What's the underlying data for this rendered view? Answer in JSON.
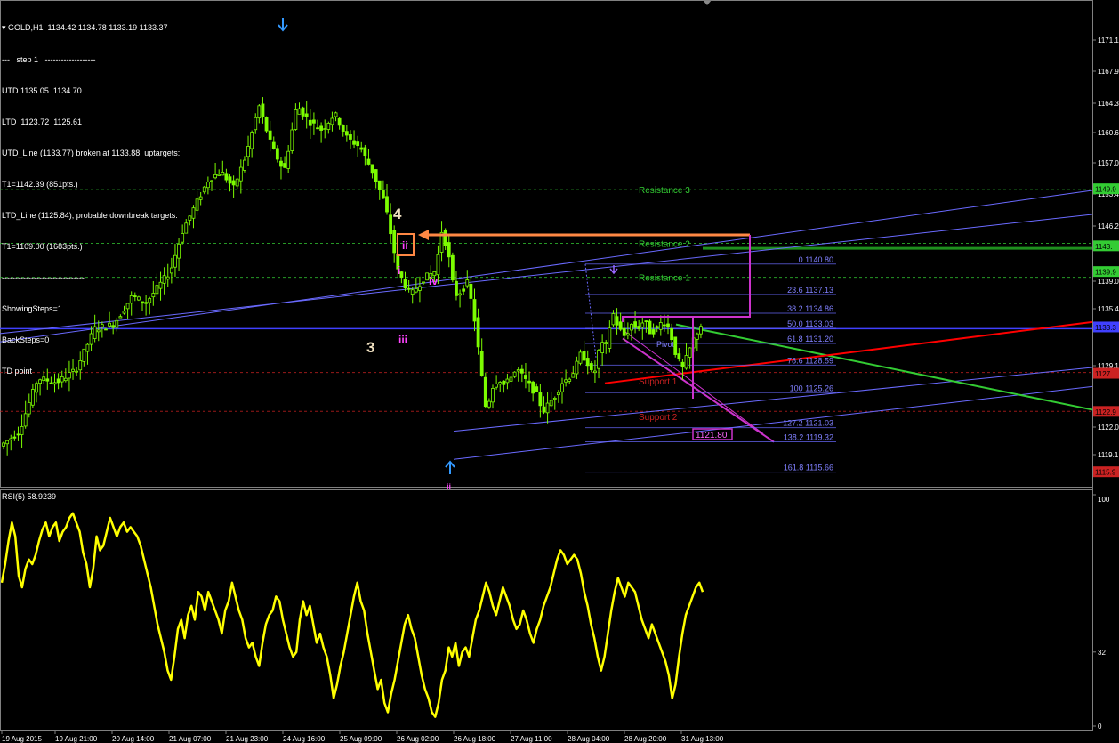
{
  "header": {
    "symbol_line": "GOLD,H1  1134.42 1134.78 1133.19 1133.37",
    "info_lines": [
      "---   step 1   -------------------",
      "UTD 1135.05  1134.70",
      "LTD  1123.72  1125.61",
      "UTD_Line (1133.77) broken at 1133.88, uptargets:",
      "T1=1142.39 (851pts.)",
      "LTD_Line (1125.84), probable downbreak targets:",
      "T1=1109.00 (1683pts.)",
      "-------------------------------",
      "ShowingSteps=1",
      "BackSteps=0",
      "TD point"
    ]
  },
  "rsi": {
    "title": "RSI(5) 58.9239",
    "scale_labels": [
      "100",
      "32",
      "0"
    ]
  },
  "colors": {
    "candle": "#7CFC00",
    "rsi_line": "#FFFF00",
    "blue_line": "#4040FF",
    "trend_blue": "#6A6AFF",
    "green_trend": "#33CC33",
    "red_trend": "#FF0000",
    "magenta": "#CC33CC",
    "orange": "#FF8844",
    "resistance_text": "#33CC33",
    "support_text": "#CC2222",
    "fib_text": "#8080FF"
  },
  "chart_data": [
    {
      "type": "candlestick",
      "symbol": "GOLD",
      "timeframe": "H1",
      "ylim": [
        1114.0,
        1172.5
      ],
      "y_ticks": [
        "1171.1",
        "1167.9",
        "1164.3",
        "1160.6",
        "1157.0",
        "1153.4",
        "1146.2",
        "1139.0",
        "1135.4",
        "1129.1",
        "1122.0",
        "1119.1"
      ],
      "x_ticks": [
        "19 Aug 2015",
        "19 Aug 21:00",
        "20 Aug 14:00",
        "21 Aug 07:00",
        "21 Aug 23:00",
        "24 Aug 16:00",
        "25 Aug 09:00",
        "26 Aug 02:00",
        "26 Aug 18:00",
        "27 Aug 11:00",
        "28 Aug 04:00",
        "28 Aug 20:00",
        "31 Aug 13:00"
      ],
      "price_boxes": [
        {
          "label": "1149.9",
          "value": 1149.9,
          "color": "#33CC33"
        },
        {
          "label": "1143.",
          "value": 1143.0,
          "color": "#33CC33"
        },
        {
          "label": "1139.9",
          "value": 1139.9,
          "color": "#33CC33"
        },
        {
          "label": "1133.3",
          "value": 1133.2,
          "color": "#4040FF"
        },
        {
          "label": "1127.",
          "value": 1127.6,
          "color": "#CC2222"
        },
        {
          "label": "1122.9",
          "value": 1123.0,
          "color": "#CC2222"
        },
        {
          "label": "1115.9",
          "value": 1115.7,
          "color": "#CC2222"
        }
      ],
      "horizontal_lines": [
        {
          "name": "Resistance 3",
          "value": 1149.8,
          "color": "#33CC33",
          "style": "dashed"
        },
        {
          "name": "Resistance 2",
          "value": 1143.3,
          "color": "#33CC33",
          "style": "dashed"
        },
        {
          "name": "Resistance 1",
          "value": 1139.2,
          "color": "#33CC33",
          "style": "dashed"
        },
        {
          "name": "Support 1",
          "value": 1127.7,
          "color": "#CC2222",
          "style": "dashed"
        },
        {
          "name": "Support 2",
          "value": 1123.0,
          "color": "#CC2222",
          "style": "dashed"
        }
      ],
      "level_labels": [
        {
          "text": "Resistance 3",
          "value": 1149.8,
          "color": "#33CC33"
        },
        {
          "text": "Resistance 2",
          "value": 1143.3,
          "color": "#33CC33"
        },
        {
          "text": "Resistance 1",
          "value": 1139.2,
          "color": "#33CC33"
        },
        {
          "text": "Support 1",
          "value": 1126.7,
          "color": "#CC2222"
        },
        {
          "text": "Support 2",
          "value": 1122.4,
          "color": "#CC2222"
        }
      ],
      "fib_levels": [
        {
          "label": "0 1140.80",
          "value": 1140.8
        },
        {
          "label": "23.6 1137.13",
          "value": 1137.13
        },
        {
          "label": "38.2 1134.86",
          "value": 1134.86
        },
        {
          "label": "50.0 1133.03",
          "value": 1133.03
        },
        {
          "label": "61.8 1131.20",
          "value": 1131.2
        },
        {
          "label": "78.6 1128.59",
          "value": 1128.59
        },
        {
          "label": "100 1125.26",
          "value": 1125.26
        },
        {
          "label": "127.2 1121.03",
          "value": 1121.03
        },
        {
          "label": "138.2 1119.32",
          "value": 1119.32
        },
        {
          "label": "161.8 1115.66",
          "value": 1115.66
        }
      ],
      "pivot_label": "Pivot",
      "target_box_label": "1121.80",
      "wave_labels": [
        "4",
        "3",
        "ii",
        "i",
        "iv",
        "iii"
      ],
      "candle_count": 192,
      "price_path": [
        [
          0,
          1118.8
        ],
        [
          6,
          1120.5
        ],
        [
          12,
          1127.0
        ],
        [
          18,
          1126.5
        ],
        [
          24,
          1128.0
        ],
        [
          30,
          1133.0
        ],
        [
          36,
          1133.5
        ],
        [
          42,
          1137.0
        ],
        [
          46,
          1136.0
        ],
        [
          50,
          1138.0
        ],
        [
          54,
          1140.0
        ],
        [
          58,
          1145.0
        ],
        [
          62,
          1148.0
        ],
        [
          66,
          1151.0
        ],
        [
          70,
          1152.0
        ],
        [
          74,
          1150.0
        ],
        [
          78,
          1154.0
        ],
        [
          82,
          1160.0
        ],
        [
          86,
          1155.0
        ],
        [
          90,
          1152.0
        ],
        [
          94,
          1160.0
        ],
        [
          98,
          1158.0
        ],
        [
          102,
          1157.0
        ],
        [
          106,
          1159.0
        ],
        [
          110,
          1156.0
        ],
        [
          114,
          1155.0
        ],
        [
          118,
          1152.0
        ],
        [
          122,
          1148.0
        ],
        [
          126,
          1140.0
        ],
        [
          130,
          1137.0
        ],
        [
          134,
          1139.0
        ],
        [
          138,
          1140.0
        ],
        [
          140,
          1145.0
        ],
        [
          142,
          1142.0
        ],
        [
          144,
          1137.0
        ],
        [
          146,
          1137.5
        ],
        [
          148,
          1138.5
        ],
        [
          150,
          1135.0
        ],
        [
          152,
          1129.0
        ],
        [
          154,
          1123.0
        ],
        [
          156,
          1126.0
        ],
        [
          158,
          1127.0
        ],
        [
          160,
          1126.0
        ],
        [
          162,
          1127.5
        ],
        [
          164,
          1128.0
        ],
        [
          166,
          1127.0
        ],
        [
          168,
          1126.0
        ],
        [
          170,
          1125.0
        ],
        [
          172,
          1123.0
        ],
        [
          174,
          1124.0
        ],
        [
          176,
          1125.0
        ],
        [
          178,
          1126.5
        ],
        [
          180,
          1127.0
        ],
        [
          182,
          1128.0
        ],
        [
          184,
          1130.0
        ],
        [
          186,
          1129.0
        ],
        [
          188,
          1127.0
        ],
        [
          190,
          1131.0
        ],
        [
          192,
          1131.0
        ],
        [
          194,
          1135.0
        ],
        [
          196,
          1133.0
        ],
        [
          198,
          1132.0
        ],
        [
          200,
          1133.5
        ],
        [
          202,
          1133.0
        ],
        [
          204,
          1134.0
        ],
        [
          206,
          1132.5
        ],
        [
          208,
          1133.0
        ],
        [
          210,
          1134.0
        ],
        [
          212,
          1133.0
        ],
        [
          214,
          1130.0
        ],
        [
          216,
          1128.0
        ],
        [
          218,
          1130.0
        ],
        [
          220,
          1132.0
        ],
        [
          222,
          1133.4
        ]
      ]
    },
    {
      "type": "line",
      "name": "RSI(5) 58.9239",
      "ylim": [
        0,
        100
      ],
      "y_ticks": [
        100,
        32,
        0
      ],
      "x_count": 222,
      "points": [
        [
          0,
          62
        ],
        [
          1,
          70
        ],
        [
          2,
          80
        ],
        [
          3,
          88
        ],
        [
          4,
          82
        ],
        [
          5,
          65
        ],
        [
          6,
          60
        ],
        [
          7,
          68
        ],
        [
          8,
          72
        ],
        [
          9,
          70
        ],
        [
          10,
          74
        ],
        [
          11,
          80
        ],
        [
          12,
          85
        ],
        [
          13,
          88
        ],
        [
          14,
          82
        ],
        [
          15,
          86
        ],
        [
          16,
          88
        ],
        [
          17,
          80
        ],
        [
          18,
          84
        ],
        [
          19,
          86
        ],
        [
          20,
          90
        ],
        [
          21,
          92
        ],
        [
          22,
          88
        ],
        [
          23,
          84
        ],
        [
          24,
          75
        ],
        [
          25,
          70
        ],
        [
          26,
          60
        ],
        [
          27,
          68
        ],
        [
          28,
          82
        ],
        [
          29,
          76
        ],
        [
          30,
          78
        ],
        [
          31,
          84
        ],
        [
          32,
          90
        ],
        [
          33,
          86
        ],
        [
          34,
          82
        ],
        [
          35,
          86
        ],
        [
          36,
          88
        ],
        [
          37,
          84
        ],
        [
          38,
          86
        ],
        [
          39,
          84
        ],
        [
          40,
          82
        ],
        [
          41,
          78
        ],
        [
          42,
          72
        ],
        [
          43,
          66
        ],
        [
          44,
          60
        ],
        [
          45,
          52
        ],
        [
          46,
          44
        ],
        [
          47,
          38
        ],
        [
          48,
          32
        ],
        [
          49,
          24
        ],
        [
          50,
          20
        ],
        [
          51,
          30
        ],
        [
          52,
          42
        ],
        [
          53,
          46
        ],
        [
          54,
          38
        ],
        [
          55,
          48
        ],
        [
          56,
          52
        ],
        [
          57,
          46
        ],
        [
          58,
          58
        ],
        [
          59,
          56
        ],
        [
          60,
          50
        ],
        [
          61,
          58
        ],
        [
          62,
          54
        ],
        [
          63,
          50
        ],
        [
          64,
          46
        ],
        [
          65,
          40
        ],
        [
          66,
          50
        ],
        [
          67,
          54
        ],
        [
          68,
          62
        ],
        [
          69,
          56
        ],
        [
          70,
          50
        ],
        [
          71,
          46
        ],
        [
          72,
          38
        ],
        [
          73,
          34
        ],
        [
          74,
          36
        ],
        [
          75,
          30
        ],
        [
          76,
          26
        ],
        [
          77,
          36
        ],
        [
          78,
          44
        ],
        [
          79,
          48
        ],
        [
          80,
          50
        ],
        [
          81,
          56
        ],
        [
          82,
          54
        ],
        [
          83,
          46
        ],
        [
          84,
          40
        ],
        [
          85,
          34
        ],
        [
          86,
          30
        ],
        [
          87,
          32
        ],
        [
          88,
          46
        ],
        [
          89,
          54
        ],
        [
          90,
          48
        ],
        [
          91,
          52
        ],
        [
          92,
          44
        ],
        [
          93,
          36
        ],
        [
          94,
          40
        ],
        [
          95,
          34
        ],
        [
          96,
          30
        ],
        [
          97,
          22
        ],
        [
          98,
          12
        ],
        [
          99,
          18
        ],
        [
          100,
          26
        ],
        [
          101,
          32
        ],
        [
          102,
          40
        ],
        [
          103,
          48
        ],
        [
          104,
          56
        ],
        [
          105,
          62
        ],
        [
          106,
          54
        ],
        [
          107,
          50
        ],
        [
          108,
          40
        ],
        [
          109,
          32
        ],
        [
          110,
          24
        ],
        [
          111,
          16
        ],
        [
          112,
          20
        ],
        [
          113,
          10
        ],
        [
          114,
          6
        ],
        [
          115,
          14
        ],
        [
          116,
          20
        ],
        [
          117,
          28
        ],
        [
          118,
          36
        ],
        [
          119,
          44
        ],
        [
          120,
          48
        ],
        [
          121,
          42
        ],
        [
          122,
          38
        ],
        [
          123,
          30
        ],
        [
          124,
          22
        ],
        [
          125,
          16
        ],
        [
          126,
          12
        ],
        [
          127,
          6
        ],
        [
          128,
          4
        ],
        [
          129,
          10
        ],
        [
          130,
          20
        ],
        [
          131,
          24
        ],
        [
          132,
          34
        ],
        [
          133,
          30
        ],
        [
          134,
          36
        ],
        [
          135,
          26
        ],
        [
          136,
          32
        ],
        [
          137,
          34
        ],
        [
          138,
          30
        ],
        [
          139,
          38
        ],
        [
          140,
          46
        ],
        [
          141,
          50
        ],
        [
          142,
          56
        ],
        [
          143,
          62
        ],
        [
          144,
          58
        ],
        [
          145,
          52
        ],
        [
          146,
          48
        ],
        [
          147,
          54
        ],
        [
          148,
          60
        ],
        [
          149,
          56
        ],
        [
          150,
          52
        ],
        [
          151,
          46
        ],
        [
          152,
          42
        ],
        [
          153,
          44
        ],
        [
          154,
          50
        ],
        [
          155,
          46
        ],
        [
          156,
          40
        ],
        [
          157,
          36
        ],
        [
          158,
          42
        ],
        [
          159,
          46
        ],
        [
          160,
          52
        ],
        [
          161,
          56
        ],
        [
          162,
          60
        ],
        [
          163,
          66
        ],
        [
          164,
          72
        ],
        [
          165,
          76
        ],
        [
          166,
          74
        ],
        [
          167,
          70
        ],
        [
          168,
          72
        ],
        [
          169,
          74
        ],
        [
          170,
          72
        ],
        [
          171,
          66
        ],
        [
          172,
          58
        ],
        [
          173,
          52
        ],
        [
          174,
          44
        ],
        [
          175,
          38
        ],
        [
          176,
          30
        ],
        [
          177,
          24
        ],
        [
          178,
          30
        ],
        [
          179,
          40
        ],
        [
          180,
          50
        ],
        [
          181,
          58
        ],
        [
          182,
          64
        ],
        [
          183,
          60
        ],
        [
          184,
          56
        ],
        [
          185,
          62
        ],
        [
          186,
          60
        ],
        [
          187,
          58
        ],
        [
          188,
          52
        ],
        [
          189,
          46
        ],
        [
          190,
          42
        ],
        [
          191,
          38
        ],
        [
          192,
          44
        ],
        [
          193,
          40
        ],
        [
          194,
          36
        ],
        [
          195,
          32
        ],
        [
          196,
          28
        ],
        [
          197,
          22
        ],
        [
          198,
          12
        ],
        [
          199,
          18
        ],
        [
          200,
          30
        ],
        [
          201,
          40
        ],
        [
          202,
          48
        ],
        [
          203,
          52
        ],
        [
          204,
          56
        ],
        [
          205,
          60
        ],
        [
          206,
          62
        ],
        [
          207,
          58
        ]
      ]
    }
  ]
}
